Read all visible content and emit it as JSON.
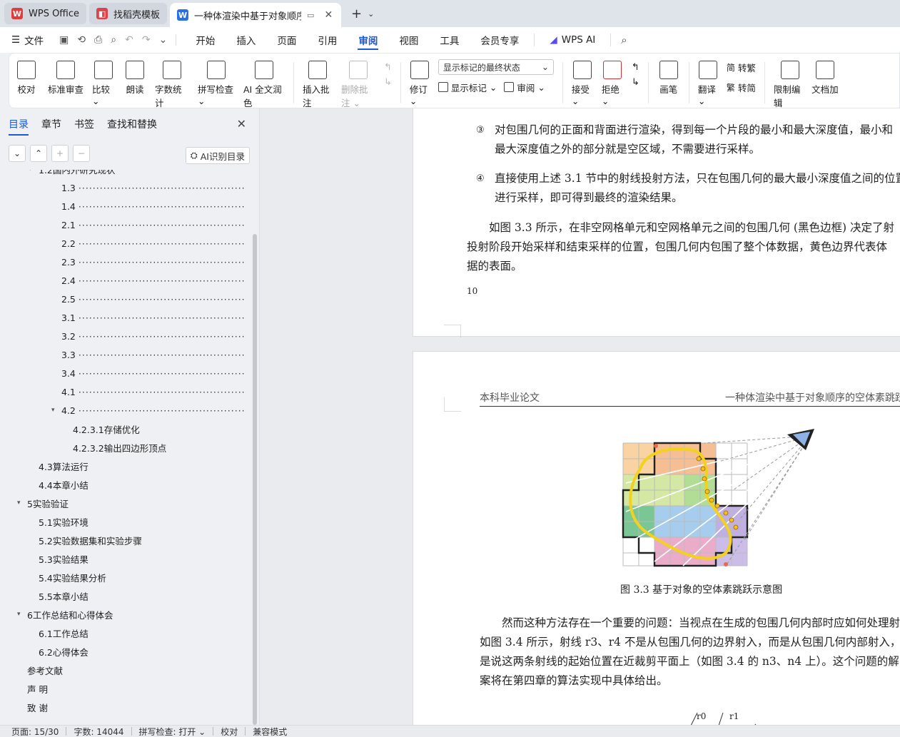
{
  "titlebar": {
    "tabs": [
      {
        "label": "WPS Office",
        "logo": "W",
        "color": "#e23b3b"
      },
      {
        "label": "找稻壳模板",
        "logo": "◧",
        "color": "#e0424b"
      },
      {
        "label": "一种体渲染中基于对象顺序的",
        "logo": "W",
        "color": "#2a6ee8"
      }
    ]
  },
  "menubar": {
    "file": "文件",
    "items": [
      "开始",
      "插入",
      "页面",
      "引用",
      "审阅",
      "视图",
      "工具",
      "会员专享"
    ],
    "active": "审阅",
    "wps_ai": "WPS AI"
  },
  "ribbon": {
    "proofread": "校对",
    "std_review": "标准审查",
    "compare": "比较",
    "read_aloud": "朗读",
    "word_count": "字数统计",
    "spell_check": "拼写检查",
    "ai_polish": "AI 全文润色",
    "insert_comment": "插入批注",
    "delete_comment": "删除批注",
    "markup_select": "显示标记的最终状态",
    "revise": "修订",
    "show_markup": "显示标记",
    "review": "审阅",
    "accept": "接受",
    "reject": "拒绝",
    "pen": "画笔",
    "translate": "翻译",
    "to_traditional": "转繁",
    "to_simplified": "转简",
    "restrict_edit": "限制编辑",
    "doc_encrypt": "文档加"
  },
  "leftpanel": {
    "tabs": [
      "目录",
      "章节",
      "书签",
      "查找和替换"
    ],
    "ai_toc": "AI识别目录",
    "toc": [
      {
        "label": "1.2国内外研究现状",
        "indent": 1,
        "arrow": "▾",
        "dots": false,
        "partial": true
      },
      {
        "label": "1.3",
        "indent": 2,
        "dots": true
      },
      {
        "label": "1.4",
        "indent": 2,
        "dots": true
      },
      {
        "label": "2.1",
        "indent": 2,
        "dots": true
      },
      {
        "label": "2.2",
        "indent": 2,
        "dots": true
      },
      {
        "label": "2.3",
        "indent": 2,
        "dots": true
      },
      {
        "label": "2.4",
        "indent": 2,
        "dots": true
      },
      {
        "label": "2.5",
        "indent": 2,
        "dots": true
      },
      {
        "label": "3.1",
        "indent": 2,
        "dots": true
      },
      {
        "label": "3.2",
        "indent": 2,
        "dots": true
      },
      {
        "label": "3.3",
        "indent": 2,
        "dots": true
      },
      {
        "label": "3.4",
        "indent": 2,
        "dots": true
      },
      {
        "label": "4.1",
        "indent": 2,
        "dots": true
      },
      {
        "label": "4.2",
        "indent": 2,
        "arrow": "▾",
        "dots": true
      },
      {
        "label": "4.2.3.1存储优化",
        "indent": 3,
        "dots": false
      },
      {
        "label": "4.2.3.2输出四边形顶点",
        "indent": 3,
        "dots": false
      },
      {
        "label": "4.3算法运行",
        "indent": 1,
        "dots": false
      },
      {
        "label": "4.4本章小结",
        "indent": 1,
        "dots": false
      },
      {
        "label": "5实验验证",
        "indent": 0,
        "arrow": "▾",
        "dots": false
      },
      {
        "label": "5.1实验环境",
        "indent": 1,
        "dots": false
      },
      {
        "label": "5.2实验数据集和实验步骤",
        "indent": 1,
        "dots": false
      },
      {
        "label": "5.3实验结果",
        "indent": 1,
        "dots": false
      },
      {
        "label": "5.4实验结果分析",
        "indent": 1,
        "dots": false
      },
      {
        "label": "5.5本章小结",
        "indent": 1,
        "dots": false
      },
      {
        "label": "6工作总结和心得体会",
        "indent": 0,
        "arrow": "▾",
        "dots": false
      },
      {
        "label": "6.1工作总结",
        "indent": 1,
        "dots": false
      },
      {
        "label": "6.2心得体会",
        "indent": 1,
        "dots": false
      },
      {
        "label": "参考文献",
        "indent": 0,
        "dots": false
      },
      {
        "label": "声 明",
        "indent": 0,
        "dots": false
      },
      {
        "label": "致 谢",
        "indent": 0,
        "dots": false
      }
    ]
  },
  "page1": {
    "item3_num": "③",
    "item3_l1": "对包围几何的正面和背面进行渲染，得到每一个片段的最小和最大深度值，最小和",
    "item3_l2": "最大深度值之外的部分就是空区域，不需要进行采样。",
    "item4_num": "④",
    "item4_l1": "直接使用上述 3.1 节中的射线投射方法，只在包围几何的最大最小深度值之间的位置",
    "item4_l2": "进行采样，即可得到最终的渲染结果。",
    "para_l1": "如图 3.3 所示，在非空网格单元和空网格单元之间的包围几何 (黑色边框) 决定了射",
    "para_l2": "投射阶段开始采样和结束采样的位置，包围几何内包围了整个体数据，黄色边界代表体",
    "para_l3": "据的表面。",
    "page_num": "10"
  },
  "page2": {
    "header_left": "本科毕业论文",
    "header_right": "一种体渲染中基于对象顺序的空体素跳跃",
    "caption": "图 3.3   基于对象的空体素跳跃示意图",
    "para_l1": "然而这种方法存在一个重要的问题：当视点在生成的包围几何内部时应如何处理射",
    "para_l2": "如图 3.4 所示，射线 r3、r4 不是从包围几何的边界射入，而是从包围几何内部射入，",
    "para_l3": "是说这两条射线的起始位置在近裁剪平面上（如图 3.4 的 n3、n4 上）。这个问题的解",
    "para_l4": "案将在第四章的算法实现中具体给出。",
    "fig_r0": "r0",
    "fig_r1": "r1"
  },
  "statusbar": {
    "page": "页面: 15/30",
    "words": "字数: 14044",
    "spell": "拼写检查: 打开",
    "proof": "校对",
    "compat": "兼容模式"
  }
}
